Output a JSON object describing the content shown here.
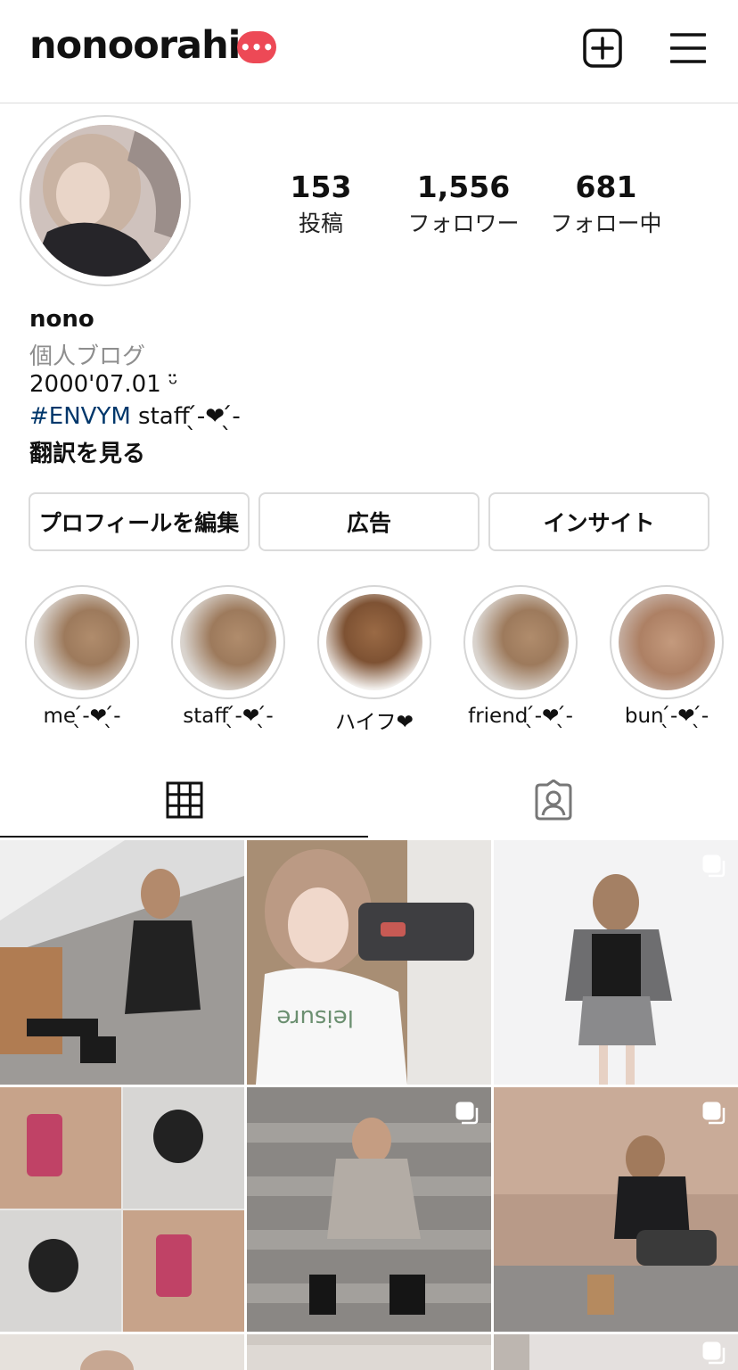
{
  "header": {
    "username": "nonoorahi",
    "badge_text": "•••"
  },
  "stats": [
    {
      "num": "153",
      "label": "投稿"
    },
    {
      "num": "1,556",
      "label": "フォロワー"
    },
    {
      "num": "681",
      "label": "フォロー中"
    }
  ],
  "profile": {
    "name": "nono",
    "category": "個人ブログ",
    "birth": "2000'07.01 ᵕ̈",
    "hashtag": "#ENVYM",
    "tag_rest": " staff ̖́-❤︎ ̖́-",
    "translate": "翻訳を見る"
  },
  "buttons": {
    "edit": "プロフィールを編集",
    "ads": "広告",
    "insights": "インサイト"
  },
  "highlights": [
    {
      "label": "me ̖́-❤︎ ̖́-"
    },
    {
      "label": "staff ̖́-❤︎ ̖́-"
    },
    {
      "label": "ハイフ❤︎"
    },
    {
      "label": "friend ̖́-❤︎ ̖́-"
    },
    {
      "label": "bun ̖́-❤︎ ̖́-"
    }
  ],
  "colors": {
    "accent_badge": "#ed4956",
    "hashtag": "#00376b",
    "muted": "#8e8e8e",
    "border": "#dbdbdb"
  },
  "icons": [
    "new-post-icon",
    "menu-icon",
    "grid-icon",
    "tagged-icon",
    "multi-photo-icon"
  ]
}
